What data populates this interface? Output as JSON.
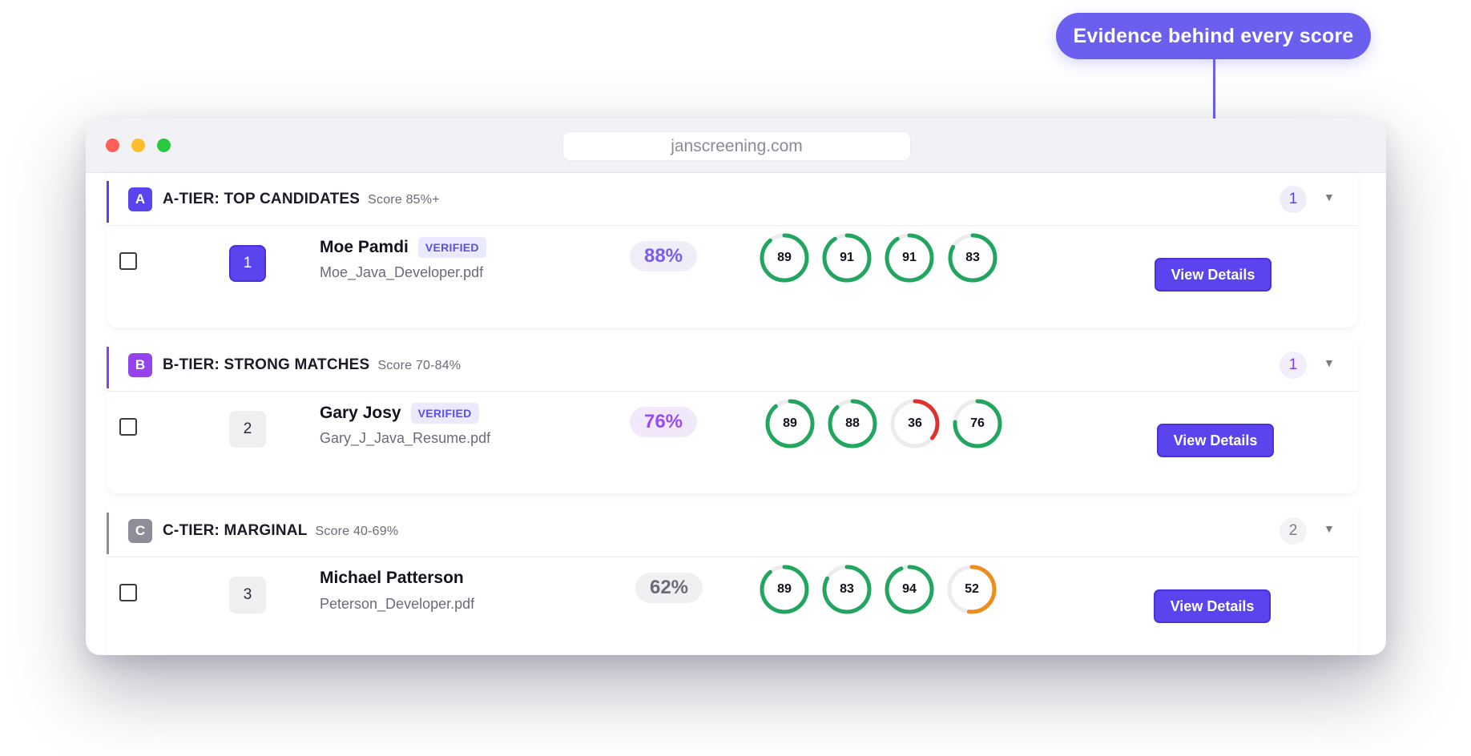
{
  "callout": {
    "text": "Evidence behind every score"
  },
  "browser": {
    "url": "janscreening.com"
  },
  "tiers": [
    {
      "letter": "A",
      "title": "A-TIER: TOP CANDIDATES",
      "range": "Score 85%+",
      "count": "1",
      "accent": "#5b44ee",
      "letter_bg": "#5b44ee",
      "count_bg": "#efeef8",
      "count_color": "#5b44ee",
      "candidate": {
        "rank": "1",
        "name": "Moe Pamdi",
        "verified": "VERIFIED",
        "file": "Moe_Java_Developer.pdf",
        "score": "88%",
        "score_bg": "#efeef8",
        "score_color": "#7a5cf0",
        "rings": [
          {
            "value": 89,
            "color": "#22a55f"
          },
          {
            "value": 91,
            "color": "#22a55f"
          },
          {
            "value": 91,
            "color": "#22a55f"
          },
          {
            "value": 83,
            "color": "#22a55f"
          }
        ],
        "button": "View Details"
      }
    },
    {
      "letter": "B",
      "title": "B-TIER: STRONG MATCHES",
      "range": "Score 70-84%",
      "count": "1",
      "accent": "#8a3ff0",
      "letter_bg": "#9443ee",
      "count_bg": "#f2eefc",
      "count_color": "#7a3fe6",
      "candidate": {
        "rank": "2",
        "name": "Gary Josy",
        "verified": "VERIFIED",
        "file": "Gary_J_Java_Resume.pdf",
        "score": "76%",
        "score_bg": "#f1e8fc",
        "score_color": "#9a4bf2",
        "rings": [
          {
            "value": 89,
            "color": "#22a55f"
          },
          {
            "value": 88,
            "color": "#22a55f"
          },
          {
            "value": 36,
            "color": "#e0312f"
          },
          {
            "value": 76,
            "color": "#22a55f"
          }
        ],
        "button": "View Details"
      }
    },
    {
      "letter": "C",
      "title": "C-TIER: MARGINAL",
      "range": "Score 40-69%",
      "count": "2",
      "accent": "#8e8e99",
      "letter_bg": "#8e8e99",
      "count_bg": "#f3f3f5",
      "count_color": "#7b7b86",
      "candidate": {
        "rank": "3",
        "name": "Michael Patterson",
        "verified": "",
        "file": "Peterson_Developer.pdf",
        "score": "62%",
        "score_bg": "#f0f0f2",
        "score_color": "#6b6b78",
        "rings": [
          {
            "value": 89,
            "color": "#22a55f"
          },
          {
            "value": 83,
            "color": "#22a55f"
          },
          {
            "value": 94,
            "color": "#22a55f"
          },
          {
            "value": 52,
            "color": "#ee8d1c"
          }
        ],
        "button": "View Details"
      }
    }
  ]
}
